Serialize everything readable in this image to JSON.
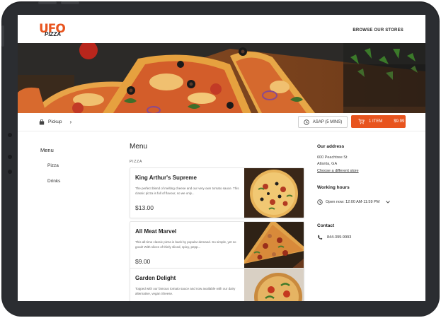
{
  "brand": {
    "logo_main": "UFO",
    "logo_sub": "PIZZA"
  },
  "header": {
    "browse_link": "BROWSE OUR STORES"
  },
  "order_bar": {
    "pickup_label": "Pickup",
    "asap_label": "ASAP (5 MINS)",
    "cart_items": "1 ITEM",
    "cart_total": "$9.99"
  },
  "sidebar": {
    "title": "Menu",
    "items": [
      {
        "label": "Pizza"
      },
      {
        "label": "Drinks"
      }
    ]
  },
  "menu": {
    "heading": "Menu",
    "category_label": "PIZZA",
    "items": [
      {
        "name": "King Arthur's Supreme",
        "description": "The perfect blend of melting cheese and our very own tomato sauce. This classic pizza is full of flavour, so we only...",
        "price": "$13.00"
      },
      {
        "name": "All Meat Marvel",
        "description": "This all-time classic pizza is back by popular demand. So simple, yet so good! With slices of thinly sliced, spicy, pepp...",
        "price": "$9.00"
      },
      {
        "name": "Garden Delight",
        "description": "Topped with our famous tomato sauce and now available with our dairy alternative, vegan Sheese.",
        "price": ""
      }
    ]
  },
  "store_info": {
    "address_title": "Our address",
    "address_line1": "600 Peachtree St",
    "address_line2": "Atlanta, GA",
    "change_store": "Choose a different store",
    "hours_title": "Working hours",
    "hours_text": "Open now: 12:00 AM-11:59 PM",
    "contact_title": "Contact",
    "phone": "844-399-9993"
  },
  "colors": {
    "accent": "#e8541e",
    "device_frame": "#2b2d31"
  },
  "icons": {
    "pickup": "bag-icon",
    "clock": "clock-icon",
    "cart": "cart-icon",
    "phone": "phone-icon",
    "chevron": "chevron-right-icon",
    "dropdown": "chevron-down-icon"
  }
}
